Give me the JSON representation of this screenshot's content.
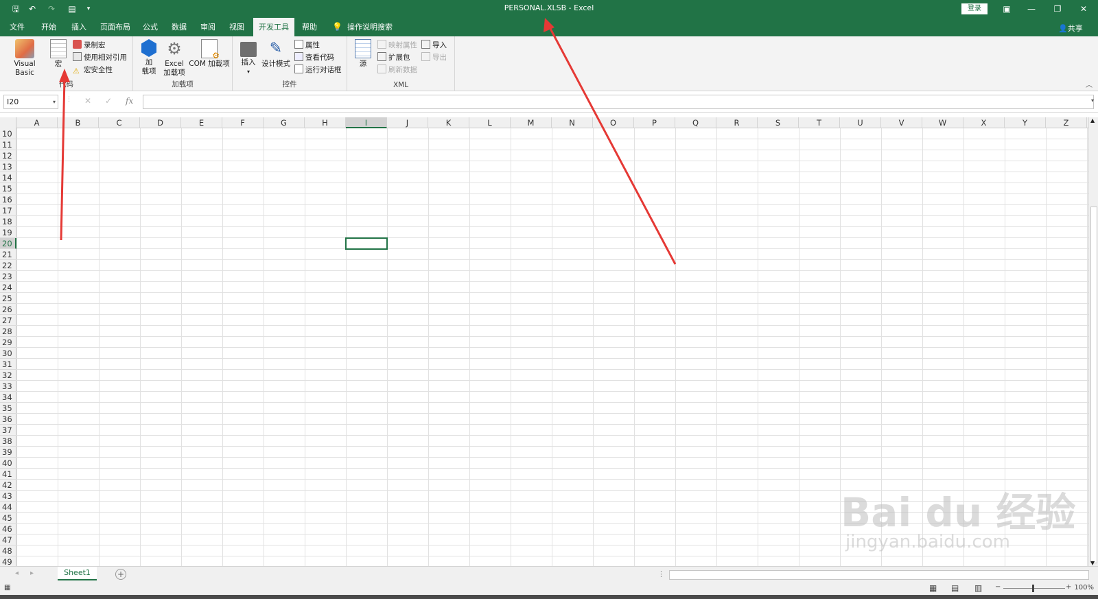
{
  "title_bar": {
    "doc_title": "PERSONAL.XLSB  -  Excel",
    "login": "登录"
  },
  "tabs": [
    {
      "label": "文件"
    },
    {
      "label": "开始"
    },
    {
      "label": "插入"
    },
    {
      "label": "页面布局"
    },
    {
      "label": "公式"
    },
    {
      "label": "数据"
    },
    {
      "label": "审阅"
    },
    {
      "label": "视图"
    },
    {
      "label": "开发工具",
      "active": true
    },
    {
      "label": "帮助"
    },
    {
      "label": "操作说明搜索"
    }
  ],
  "share": "共享",
  "ribbon": {
    "code": {
      "label": "代码",
      "visual_basic": "Visual Basic",
      "macros": "宏",
      "record": "录制宏",
      "relative": "使用相对引用",
      "security": "宏安全性"
    },
    "addins": {
      "label": "加载项",
      "addin_line1": "加",
      "addin_line2": "载项",
      "excel_line1": "Excel",
      "excel_line2": "加载项",
      "com": "COM 加载项"
    },
    "controls": {
      "label": "控件",
      "insert": "插入",
      "design_mode": "设计模式",
      "properties": "属性",
      "view_code": "查看代码",
      "run_dialog": "运行对话框"
    },
    "xml": {
      "label": "XML",
      "source": "源",
      "map_props": "映射属性",
      "expansion": "扩展包",
      "refresh": "刷新数据",
      "import": "导入",
      "export": "导出"
    }
  },
  "formula_bar": {
    "name_box": "I20",
    "fx": "fx"
  },
  "columns": [
    "A",
    "B",
    "C",
    "D",
    "E",
    "F",
    "G",
    "H",
    "I",
    "J",
    "K",
    "L",
    "M",
    "N",
    "O",
    "P",
    "Q",
    "R",
    "S",
    "T",
    "U",
    "V",
    "W",
    "X",
    "Y",
    "Z"
  ],
  "selected_column": "I",
  "rows": [
    "10",
    "11",
    "12",
    "13",
    "14",
    "15",
    "16",
    "17",
    "18",
    "19",
    "20",
    "21",
    "22",
    "23",
    "24",
    "25",
    "26",
    "27",
    "28",
    "29",
    "30",
    "31",
    "32",
    "33",
    "34",
    "35",
    "36",
    "37",
    "38",
    "39",
    "40",
    "41",
    "42",
    "43",
    "44",
    "45",
    "46",
    "47",
    "48",
    "49"
  ],
  "selected_row": "20",
  "sheet_tab": "Sheet1",
  "zoom": "100%",
  "watermark": {
    "main": "Bai du 经验",
    "sub": "jingyan.baidu.com"
  },
  "colors": {
    "accent": "#217346",
    "arrow": "#e53935"
  }
}
